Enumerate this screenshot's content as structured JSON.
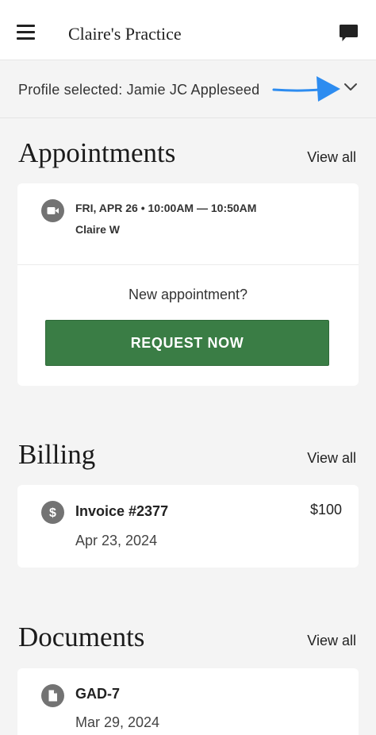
{
  "header": {
    "practice_name": "Claire's Practice",
    "menu_icon": "hamburger-menu-icon",
    "chat_icon": "chat-bubble-icon"
  },
  "profile": {
    "label": "Profile selected: Jamie JC Appleseed",
    "annotation": "blue-arrow",
    "chevron_icon": "chevron-down-icon"
  },
  "appointments": {
    "title": "Appointments",
    "view_all": "View all",
    "item": {
      "icon": "video-camera-icon",
      "when": "FRI, APR 26 • 10:00AM — 10:50AM",
      "provider": "Claire W"
    },
    "new_prompt": "New appointment?",
    "request_label": "REQUEST NOW"
  },
  "billing": {
    "title": "Billing",
    "view_all": "View all",
    "item": {
      "icon": "dollar-icon",
      "title": "Invoice #2377",
      "date": "Apr 23, 2024",
      "amount": "$100"
    }
  },
  "documents": {
    "title": "Documents",
    "view_all": "View all",
    "item": {
      "icon": "document-icon",
      "title": "GAD-7",
      "date": "Mar 29, 2024"
    }
  },
  "colors": {
    "accent_green": "#3a7d45",
    "annotation_blue": "#2d8cf0",
    "background": "#f4f4f4",
    "icon_gray": "#737373"
  }
}
